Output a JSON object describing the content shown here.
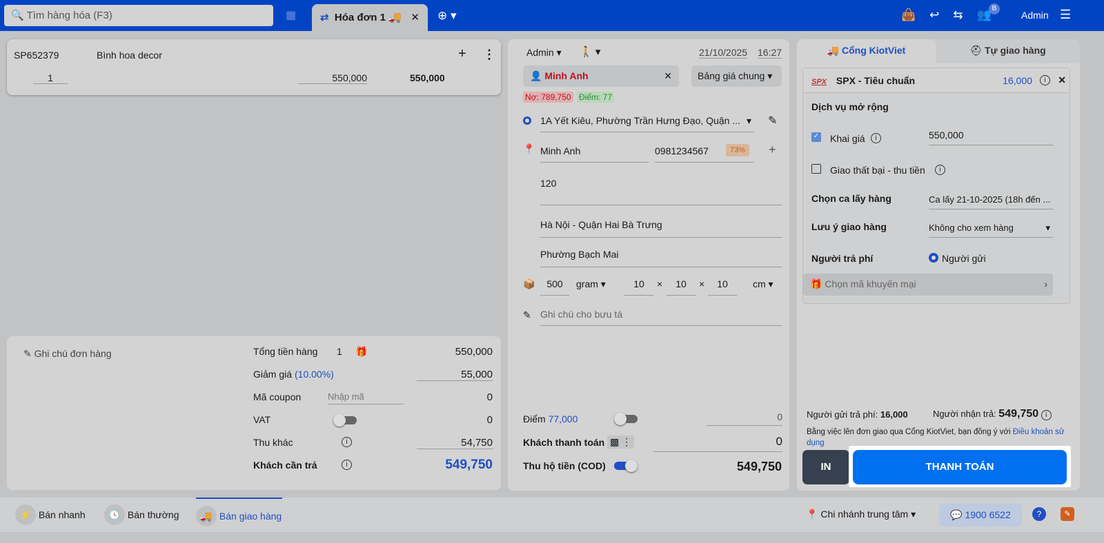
{
  "header": {
    "search_placeholder": "Tìm hàng hóa (F3)",
    "tab_label": "Hóa đơn 1",
    "user": "Admin",
    "badge": "B"
  },
  "cart": {
    "code": "SP652379",
    "name": "Bình hoa decor",
    "qty": "1",
    "price": "550,000",
    "total": "550,000"
  },
  "summary": {
    "note": "Ghi chú đơn hàng",
    "rows": [
      {
        "label": "Tổng tiền hàng",
        "extra": "1",
        "value": "550,000"
      },
      {
        "label": "Giảm giá",
        "extra": "(10.00%)",
        "value": "55,000"
      },
      {
        "label": "Mã coupon",
        "extra": "Nhập mã",
        "value": "0"
      },
      {
        "label": "VAT",
        "extra": "",
        "value": "0"
      },
      {
        "label": "Thu khác",
        "extra": "",
        "value": "54,750"
      },
      {
        "label": "Khách cần trả",
        "extra": "",
        "value": "549,750"
      }
    ]
  },
  "order": {
    "seller": "Admin",
    "date": "21/10/2025",
    "time": "16:27",
    "customer": "Minh Anh",
    "price_list": "Bảng giá chung",
    "debt": "Nợ: 789,750",
    "points": "Điểm: 77",
    "pickup_address": "1A Yết Kiêu, Phường Trần Hưng Đạo, Quận ...",
    "receiver_name": "Minh Anh",
    "receiver_phone": "0981234567",
    "success_rate": "73%",
    "address": "120",
    "district": "Hà Nội - Quận Hai Bà Trưng",
    "ward": "Phường Bạch Mai",
    "weight": "500",
    "weight_unit": "gram",
    "l": "10",
    "w": "10",
    "h": "10",
    "dim_unit": "cm",
    "x": "×",
    "shipper_note_placeholder": "Ghi chú cho bưu tá",
    "points_label": "Điểm",
    "points_value": "77,000",
    "points_input": "0",
    "pay_label": "Khách thanh toán",
    "pay_value": "0",
    "cod_label": "Thu hộ tiền (COD)",
    "cod_value": "549,750"
  },
  "shipping": {
    "tab1": "Cổng KiotViet",
    "tab2": "Tự giao hàng",
    "carrier_logo": "SPX",
    "carrier": "SPX - Tiêu chuẩn",
    "fee": "16,000",
    "ext_title": "Dịch vụ mở rộng",
    "declare": "Khai giá",
    "declare_value": "550,000",
    "fail_collect": "Giao thất bại - thu tiền",
    "pickup_label": "Chọn ca lấy hàng",
    "pickup_value": "Ca lấy 21-10-2025 (18h đến ...",
    "note_label": "Lưu ý giao hàng",
    "note_value": "Không cho xem hàng",
    "payer_label": "Người trả phí",
    "payer_value": "Người gửi",
    "promo": "Chọn mã khuyến mại",
    "sender_pays": "Người gửi trả phí:",
    "sender_fee": "16,000",
    "receiver_pays": "Người nhận trả:",
    "receiver_amount": "549,750",
    "terms": "Bằng việc lên đơn giao qua Cổng KiotViet, bạn đồng ý với",
    "terms_link": "Điều khoản sử dụng",
    "print": "IN",
    "pay": "THANH TOÁN"
  },
  "footer": {
    "quick": "Bán nhanh",
    "normal": "Bán thường",
    "delivery": "Bán giao hàng",
    "branch": "Chi nhánh trung tâm",
    "hotline": "1900 6522"
  }
}
